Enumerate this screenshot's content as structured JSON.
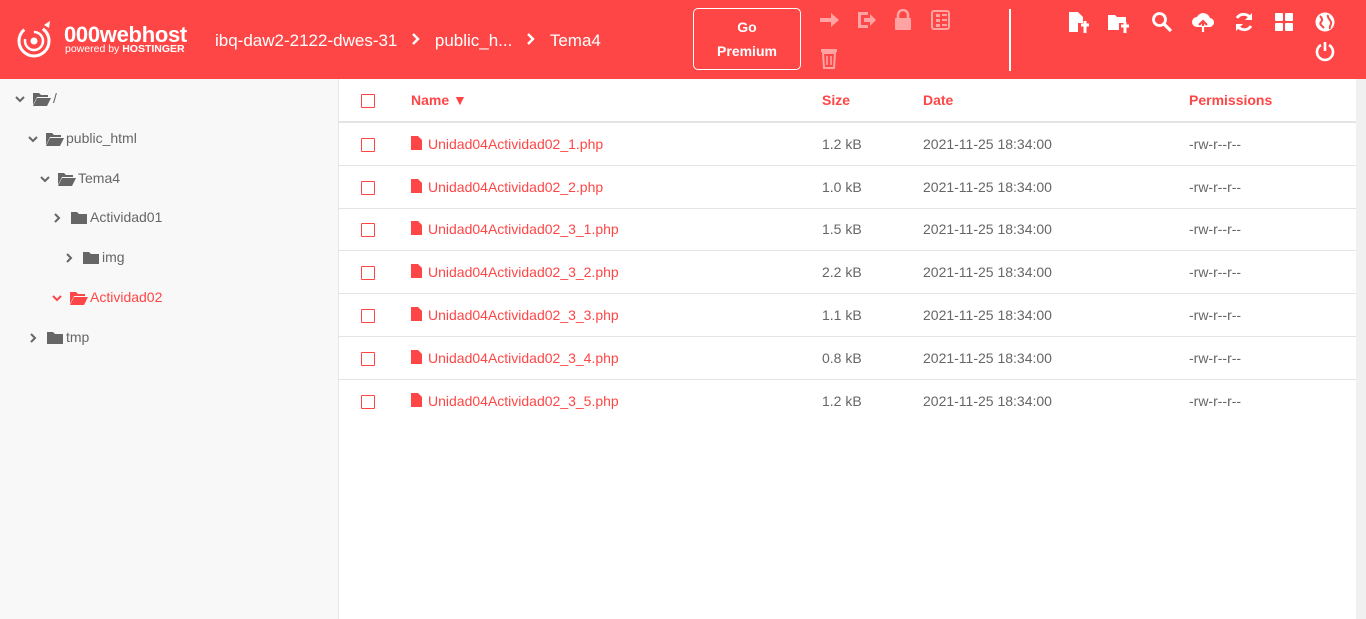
{
  "header": {
    "logo_name": "000webhost",
    "logo_sub_prefix": "powered by",
    "logo_sub_brand": "HOSTINGER",
    "breadcrumbs": [
      "ibq-daw2-2122-dwes-31",
      "public_h...",
      "Tema4"
    ],
    "premium_line1": "Go",
    "premium_line2": "Premium",
    "toolbar_icons": [
      "move-icon",
      "rename-icon",
      "permissions-icon",
      "archive-icon",
      "delete-icon",
      "new-file-icon",
      "new-folder-icon",
      "search-icon",
      "upload-icon",
      "refresh-icon",
      "grid-view-icon",
      "globe-icon",
      "power-icon"
    ]
  },
  "sidebar": {
    "tree": [
      {
        "label": "/",
        "expanded": true,
        "active": false
      },
      {
        "label": "public_html",
        "expanded": true,
        "active": false
      },
      {
        "label": "Tema4",
        "expanded": true,
        "active": false
      },
      {
        "label": "Actividad01",
        "expanded": false,
        "active": false
      },
      {
        "label": "img",
        "expanded": false,
        "active": false
      },
      {
        "label": "Actividad02",
        "expanded": true,
        "active": true
      },
      {
        "label": "tmp",
        "expanded": false,
        "active": false
      }
    ]
  },
  "table": {
    "columns": {
      "name": "Name ▼",
      "size": "Size",
      "date": "Date",
      "permissions": "Permissions"
    },
    "rows": [
      {
        "name": "Unidad04Actividad02_1.php",
        "size": "1.2 kB",
        "date": "2021-11-25 18:34:00",
        "permissions": "-rw-r--r--"
      },
      {
        "name": "Unidad04Actividad02_2.php",
        "size": "1.0 kB",
        "date": "2021-11-25 18:34:00",
        "permissions": "-rw-r--r--"
      },
      {
        "name": "Unidad04Actividad02_3_1.php",
        "size": "1.5 kB",
        "date": "2021-11-25 18:34:00",
        "permissions": "-rw-r--r--"
      },
      {
        "name": "Unidad04Actividad02_3_2.php",
        "size": "2.2 kB",
        "date": "2021-11-25 18:34:00",
        "permissions": "-rw-r--r--"
      },
      {
        "name": "Unidad04Actividad02_3_3.php",
        "size": "1.1 kB",
        "date": "2021-11-25 18:34:00",
        "permissions": "-rw-r--r--"
      },
      {
        "name": "Unidad04Actividad02_3_4.php",
        "size": "0.8 kB",
        "date": "2021-11-25 18:34:00",
        "permissions": "-rw-r--r--"
      },
      {
        "name": "Unidad04Actividad02_3_5.php",
        "size": "1.2 kB",
        "date": "2021-11-25 18:34:00",
        "permissions": "-rw-r--r--"
      }
    ]
  },
  "colors": {
    "accent": "#ff4646",
    "text": "#666666",
    "sidebar_bg": "#f8f8f8"
  }
}
